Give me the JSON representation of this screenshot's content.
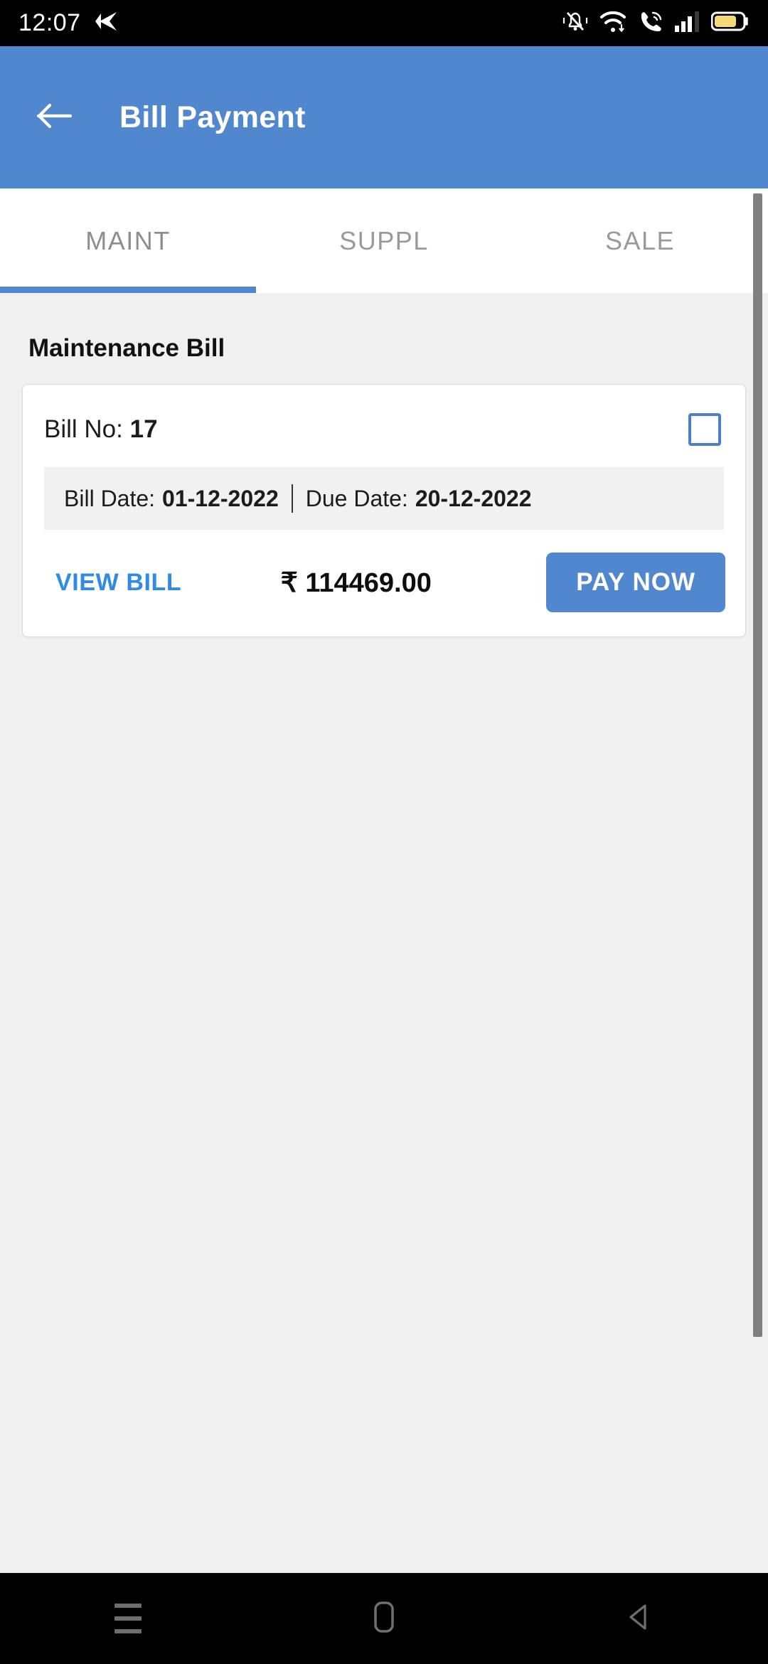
{
  "status_bar": {
    "time": "12:07",
    "icons": [
      {
        "name": "nav-back-arrow-icon"
      },
      {
        "name": "vibrate-silent-icon"
      },
      {
        "name": "wifi-icon"
      },
      {
        "name": "vowifi-call-icon"
      },
      {
        "name": "cellular-signal-icon"
      },
      {
        "name": "battery-icon"
      }
    ],
    "battery_color": "#f5da78"
  },
  "app_bar": {
    "title": "Bill Payment",
    "back_icon": "arrow-left-icon",
    "background": "#5187ce"
  },
  "tabs": {
    "items": [
      {
        "label": "MAINT",
        "active": true
      },
      {
        "label": "SUPPL",
        "active": false
      },
      {
        "label": "SALE",
        "active": false
      }
    ],
    "indicator_color": "#5187ce"
  },
  "main": {
    "section_title": "Maintenance Bill",
    "bill": {
      "bill_no_label": "Bill No:",
      "bill_no_value": "17",
      "checkbox_checked": false,
      "bill_date_label": "Bill Date:",
      "bill_date_value": "01-12-2022",
      "due_date_label": "Due Date:",
      "due_date_value": "20-12-2022",
      "view_bill_label": "VIEW BILL",
      "currency_symbol": "₹",
      "amount": "114469.00",
      "amount_display": "₹ 114469.00",
      "pay_now_label": "PAY NOW",
      "link_color": "#2f8be5",
      "button_color": "#5187ce",
      "checkbox_color": "#4d7fc4"
    }
  },
  "nav_bar": {
    "items": [
      {
        "label": "recents",
        "icon": "menu-lines-icon"
      },
      {
        "label": "home",
        "icon": "home-square-icon"
      },
      {
        "label": "back",
        "icon": "back-triangle-icon"
      }
    ]
  }
}
